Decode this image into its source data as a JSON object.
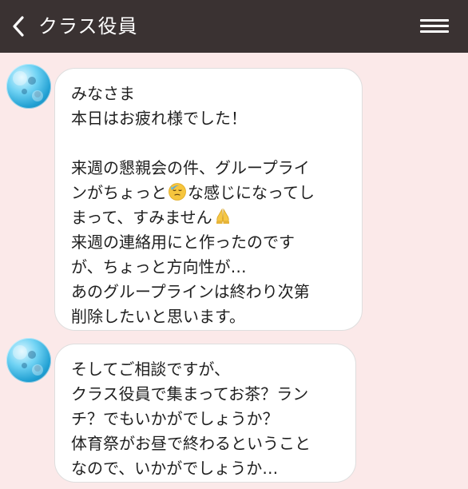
{
  "header": {
    "title": "クラス役員",
    "back_icon": "chevron-left-icon",
    "menu_icon": "hamburger-menu-icon"
  },
  "messages": [
    {
      "avatar_icon": "blue-bubbles-avatar-icon",
      "lines": [
        {
          "parts": [
            {
              "type": "text",
              "value": "みなさま"
            }
          ]
        },
        {
          "parts": [
            {
              "type": "text",
              "value": "本日はお疲れ様でした！"
            }
          ]
        },
        {
          "parts": []
        },
        {
          "parts": [
            {
              "type": "text",
              "value": "来週の懇親会の件、グループライ"
            }
          ]
        },
        {
          "parts": [
            {
              "type": "text",
              "value": "ンがちょっと"
            },
            {
              "type": "emoji",
              "name": "sweat-face-icon"
            },
            {
              "type": "text",
              "value": "な感じになってし"
            }
          ]
        },
        {
          "parts": [
            {
              "type": "text",
              "value": "まって、すみません"
            },
            {
              "type": "emoji",
              "name": "folded-hands-icon"
            }
          ]
        },
        {
          "parts": [
            {
              "type": "text",
              "value": "来週の連絡用にと作ったのです"
            }
          ]
        },
        {
          "parts": [
            {
              "type": "text",
              "value": "が、ちょっと方向性が…"
            }
          ]
        },
        {
          "parts": [
            {
              "type": "text",
              "value": "あのグループラインは終わり次第"
            }
          ]
        },
        {
          "parts": [
            {
              "type": "text",
              "value": "削除したいと思います。"
            }
          ]
        }
      ]
    },
    {
      "avatar_icon": "blue-bubbles-avatar-icon",
      "lines": [
        {
          "parts": [
            {
              "type": "text",
              "value": "そしてご相談ですが、"
            }
          ]
        },
        {
          "parts": [
            {
              "type": "text",
              "value": "クラス役員で集まってお茶？ラン"
            }
          ]
        },
        {
          "parts": [
            {
              "type": "text",
              "value": "チ？でもいかがでしょうか？"
            }
          ]
        },
        {
          "parts": [
            {
              "type": "text",
              "value": "体育祭がお昼で終わるということ"
            }
          ]
        },
        {
          "parts": [
            {
              "type": "text",
              "value": "なので、いかがでしょうか…"
            }
          ]
        }
      ]
    }
  ],
  "colors": {
    "header_bg": "#3a3232",
    "chat_bg": "#fbe9e9",
    "bubble_bg": "#ffffff",
    "text": "#1f1f1f"
  }
}
